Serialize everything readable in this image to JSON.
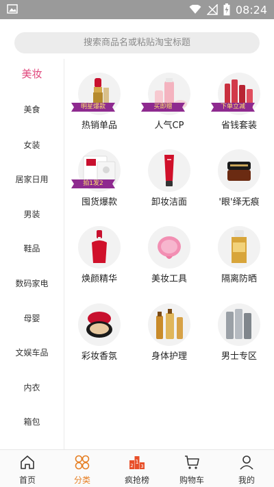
{
  "status_bar": {
    "time": "08:24"
  },
  "search": {
    "placeholder": "搜索商品名或粘贴淘宝标题"
  },
  "sidebar": {
    "items": [
      {
        "label": "美妆",
        "active": true
      },
      {
        "label": "美食"
      },
      {
        "label": "女装"
      },
      {
        "label": "居家日用"
      },
      {
        "label": "男装"
      },
      {
        "label": "鞋品"
      },
      {
        "label": "数码家电"
      },
      {
        "label": "母婴"
      },
      {
        "label": "文娱车品"
      },
      {
        "label": "内衣"
      },
      {
        "label": "箱包"
      }
    ]
  },
  "categories": [
    {
      "label": "热销单品",
      "ribbon": "明星爆款",
      "icon": "lipstick"
    },
    {
      "label": "人气CP",
      "ribbon": "买即赠",
      "icon": "skincare-set"
    },
    {
      "label": "省钱套装",
      "ribbon": "下单立减",
      "icon": "bottles-set"
    },
    {
      "label": "囤货爆款",
      "ribbon": "拍1发2",
      "icon": "face-mask"
    },
    {
      "label": "卸妆洁面",
      "icon": "cleanser-tube"
    },
    {
      "label": "'眼'绎无痕",
      "icon": "eye-cream-jar"
    },
    {
      "label": "焕颜精华",
      "icon": "serum-bottle"
    },
    {
      "label": "美妆工具",
      "icon": "cleansing-brush"
    },
    {
      "label": "隔离防晒",
      "icon": "sunscreen-bottle"
    },
    {
      "label": "彩妆香氛",
      "icon": "cushion-compact"
    },
    {
      "label": "身体护理",
      "icon": "body-oil-bottles"
    },
    {
      "label": "男士专区",
      "icon": "mens-bottles"
    }
  ],
  "bottom_nav": [
    {
      "label": "首页",
      "icon": "home-icon"
    },
    {
      "label": "分类",
      "icon": "category-icon",
      "active": true
    },
    {
      "label": "疯抢榜",
      "icon": "ranking-icon"
    },
    {
      "label": "购物车",
      "icon": "cart-icon"
    },
    {
      "label": "我的",
      "icon": "profile-icon"
    }
  ],
  "colors": {
    "accent": "#e0457b",
    "nav_active": "#e67e22",
    "status_bar": "#9a9a9a",
    "ribbon": "#8e2a8f"
  }
}
